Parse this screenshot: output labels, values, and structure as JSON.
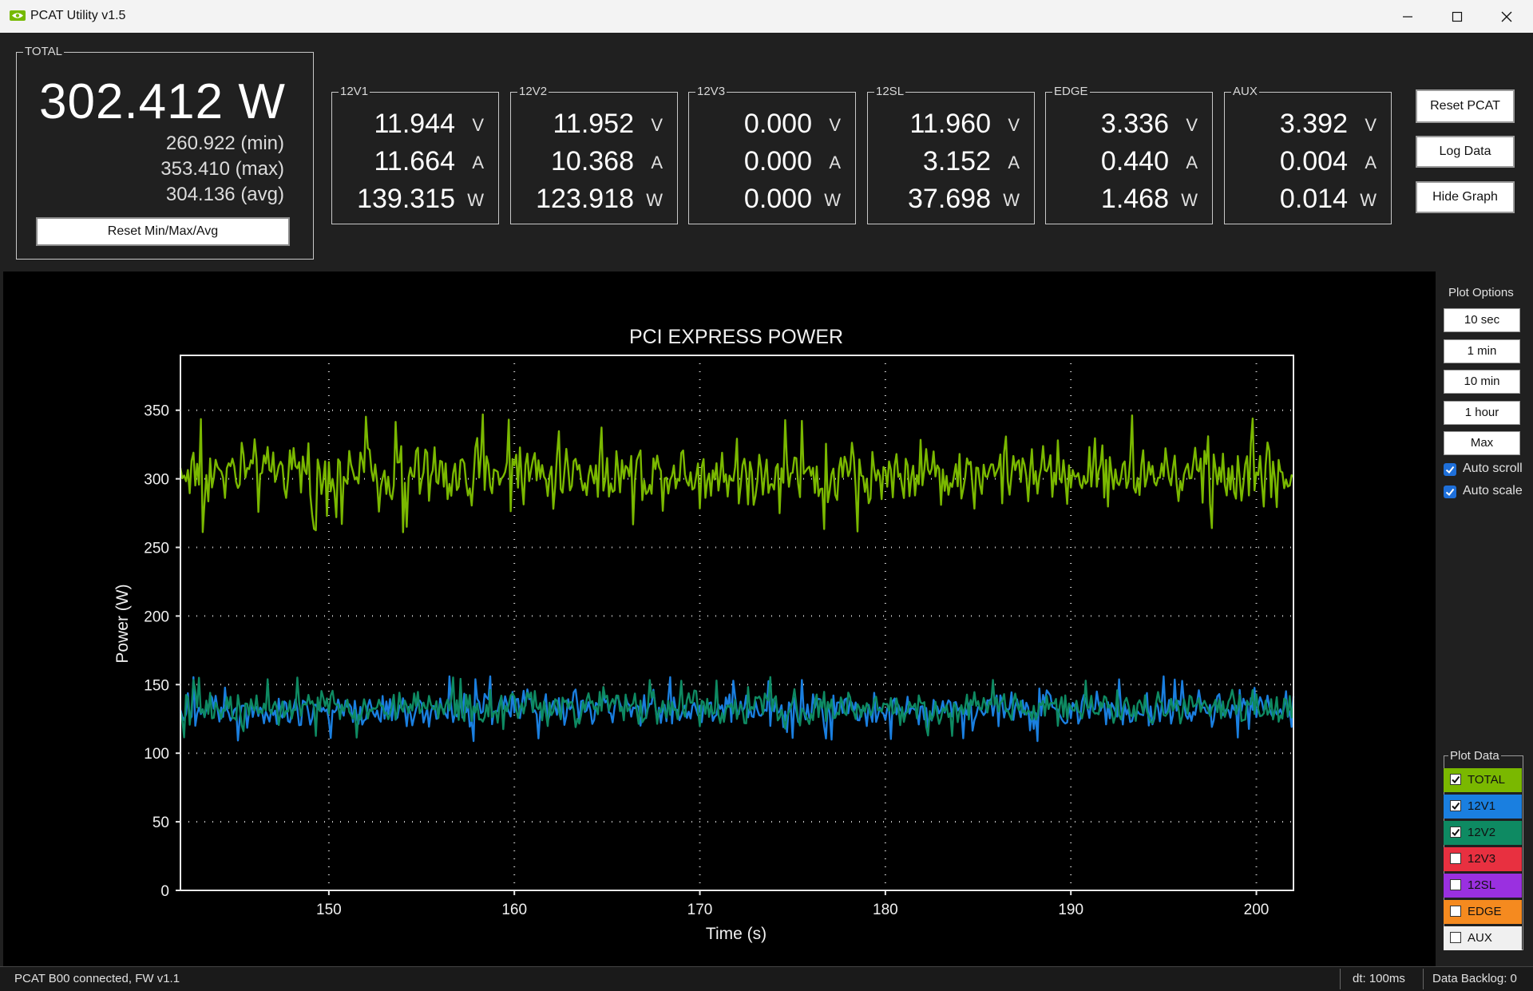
{
  "window": {
    "title": "PCAT Utility v1.5"
  },
  "total": {
    "label": "TOTAL",
    "value": "302.412 W",
    "min": "260.922 (min)",
    "max": "353.410 (max)",
    "avg": "304.136 (avg)",
    "reset_label": "Reset Min/Max/Avg"
  },
  "meters": [
    {
      "label": "12V1",
      "volts": "11.944",
      "amps": "11.664",
      "watts": "139.315"
    },
    {
      "label": "12V2",
      "volts": "11.952",
      "amps": "10.368",
      "watts": "123.918"
    },
    {
      "label": "12V3",
      "volts": "0.000",
      "amps": "0.000",
      "watts": "0.000"
    },
    {
      "label": "12SL",
      "volts": "11.960",
      "amps": "3.152",
      "watts": "37.698"
    },
    {
      "label": "EDGE",
      "volts": "3.336",
      "amps": "0.440",
      "watts": "1.468"
    },
    {
      "label": "AUX",
      "volts": "3.392",
      "amps": "0.004",
      "watts": "0.014"
    }
  ],
  "units": {
    "v": "V",
    "a": "A",
    "w": "W"
  },
  "buttons": {
    "reset_pcat": "Reset PCAT",
    "log_data": "Log Data",
    "hide_graph": "Hide Graph"
  },
  "plot_options": {
    "label": "Plot Options",
    "ranges": [
      "10 sec",
      "1 min",
      "10 min",
      "1 hour",
      "Max"
    ],
    "auto_scroll": "Auto scroll",
    "auto_scale": "Auto scale"
  },
  "plot_data": {
    "label": "Plot Data",
    "items": [
      {
        "name": "TOTAL",
        "color": "#7ab800",
        "checked": true
      },
      {
        "name": "12V1",
        "color": "#1a7fe0",
        "checked": true
      },
      {
        "name": "12V2",
        "color": "#0e8a62",
        "checked": true
      },
      {
        "name": "12V3",
        "color": "#e83040",
        "checked": false
      },
      {
        "name": "12SL",
        "color": "#9a30e0",
        "checked": false
      },
      {
        "name": "EDGE",
        "color": "#f58a1f",
        "checked": false
      },
      {
        "name": "AUX",
        "color": "#f0f0f0",
        "checked": false
      }
    ]
  },
  "status": {
    "connection": "PCAT B00 connected, FW v1.1",
    "dt": "dt: 100ms",
    "backlog": "Data Backlog: 0"
  },
  "chart_data": {
    "type": "line",
    "title": "PCI EXPRESS POWER",
    "xlabel": "Time (s)",
    "ylabel": "Power (W)",
    "xlim": [
      142,
      202
    ],
    "ylim": [
      0,
      390
    ],
    "xticks": [
      150,
      160,
      170,
      180,
      190,
      200
    ],
    "yticks": [
      0,
      50,
      100,
      150,
      200,
      250,
      300,
      350
    ],
    "grid": true,
    "series": [
      {
        "name": "TOTAL",
        "color": "#7ab800",
        "mean": 304,
        "min": 261,
        "max": 353
      },
      {
        "name": "12V1",
        "color": "#1a7fe0",
        "mean": 132,
        "min": 100,
        "max": 156
      },
      {
        "name": "12V2",
        "color": "#0e8a62",
        "mean": 133,
        "min": 103,
        "max": 156
      }
    ]
  }
}
